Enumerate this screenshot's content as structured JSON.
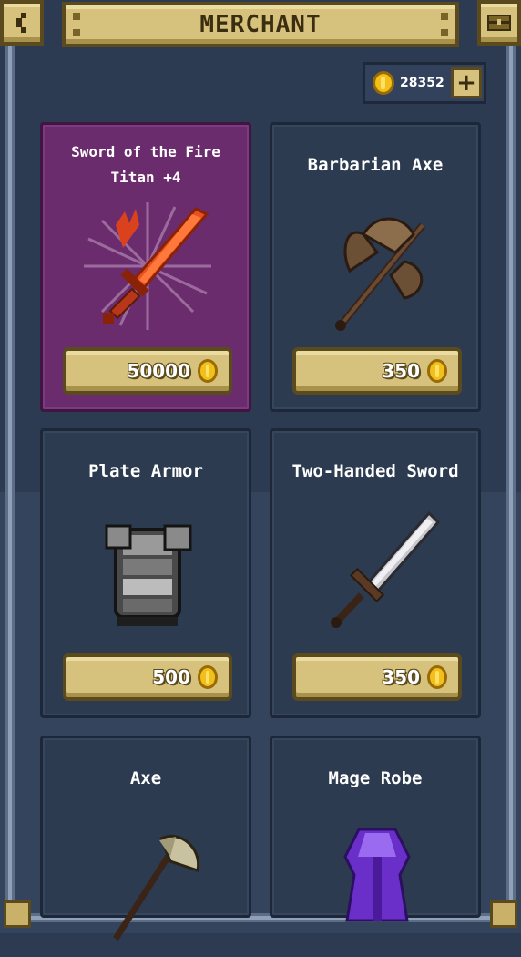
{
  "header": {
    "title": "MERCHANT",
    "back_icon": "chevron-left-icon",
    "chest_icon": "chest-icon"
  },
  "wallet": {
    "coins": "28352",
    "add_icon": "plus-icon"
  },
  "colors": {
    "gold": "#d6c27d",
    "featured_card": "#6b2c6e",
    "card": "#2c3b50",
    "background": "#2c3a52"
  },
  "items": [
    {
      "name": "Sword of the Fire Titan +4",
      "price": "50000",
      "icon": "fire-sword-icon",
      "featured": true
    },
    {
      "name": "Barbarian Axe",
      "price": "350",
      "icon": "battle-axe-icon"
    },
    {
      "name": "Plate Armor",
      "price": "500",
      "icon": "plate-armor-icon"
    },
    {
      "name": "Two-Handed Sword",
      "price": "350",
      "icon": "greatsword-icon"
    },
    {
      "name": "Axe",
      "price": "",
      "icon": "axe-icon"
    },
    {
      "name": "Mage Robe",
      "price": "",
      "icon": "mage-robe-icon"
    }
  ]
}
